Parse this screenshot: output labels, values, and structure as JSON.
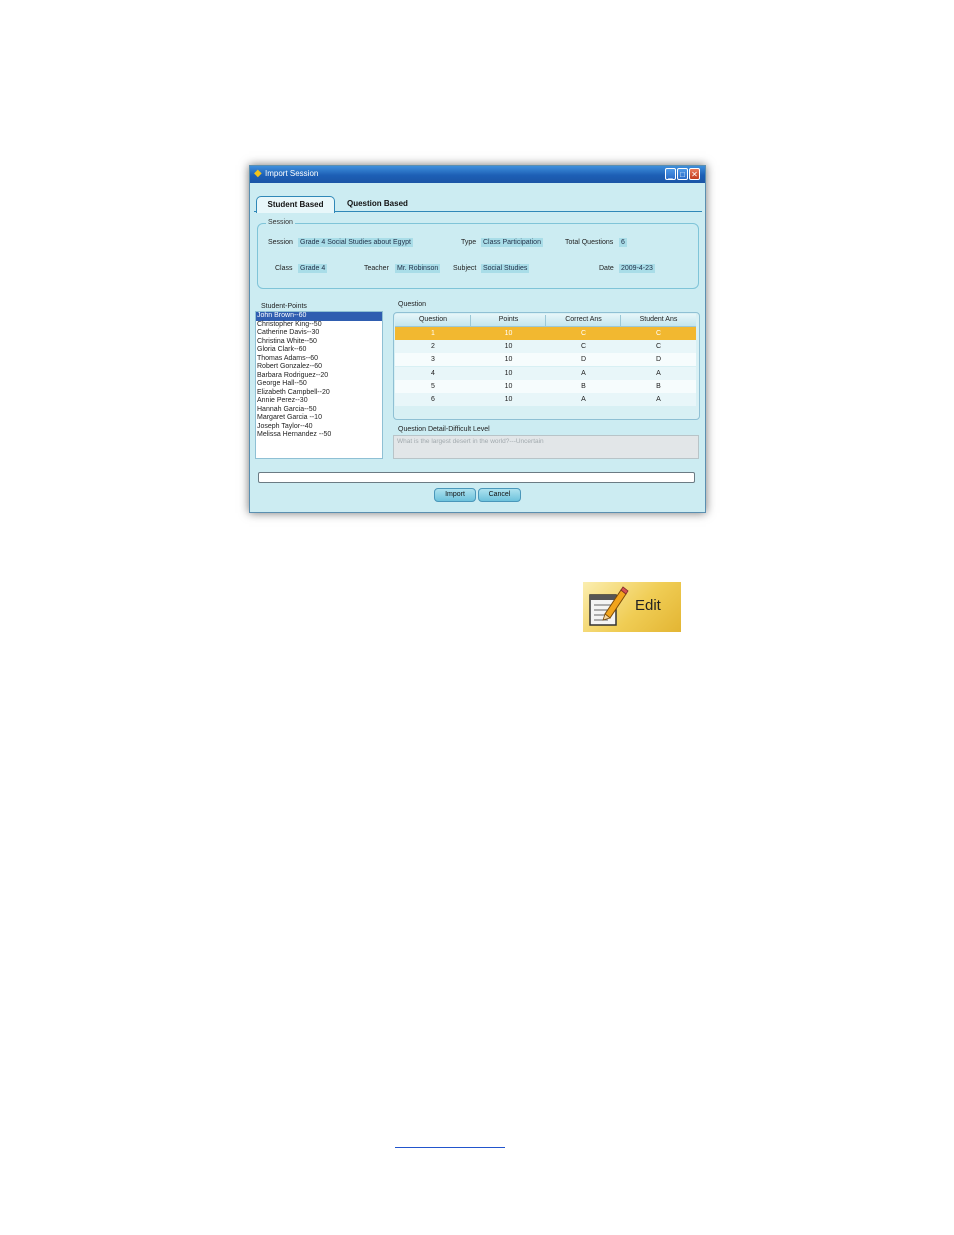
{
  "window": {
    "title": "Import Session",
    "app_icon": "app-icon",
    "controls": {
      "minimize_icon": "minimize-icon",
      "maximize_icon": "maximize-icon",
      "close_icon": "close-icon"
    }
  },
  "tabs": [
    {
      "label": "Student Based",
      "active": true
    },
    {
      "label": "Question Based",
      "active": false
    }
  ],
  "session": {
    "legend": "Session",
    "session_label": "Session",
    "session_value": "Grade 4 Social Studies about Egypt",
    "type_label": "Type",
    "type_value": "Class Participation",
    "total_label": "Total Questions",
    "total_value": "6",
    "class_label": "Class",
    "class_value": "Grade 4",
    "teacher_label": "Teacher",
    "teacher_value": "Mr. Robinson",
    "subject_label": "Subject",
    "subject_value": "Social Studies",
    "date_label": "Date",
    "date_value": "2009-4-23"
  },
  "students": {
    "legend": "Student-Points",
    "items": [
      "John Brown--60",
      "Christopher King--50",
      "Catherine Davis--30",
      "Christina White--50",
      "Gloria Clark--60",
      "Thomas Adams--60",
      "Robert Gonzalez--60",
      "Barbara Rodriguez--20",
      "George Hall--50",
      "Elizabeth Campbell--20",
      "Annie Perez--30",
      "Hannah Garcia--50",
      "Margaret Garcia --10",
      "Joseph Taylor--40",
      "Melissa Hernandez --50"
    ],
    "selected_index": 0
  },
  "questions": {
    "legend": "Question",
    "columns": [
      "Question",
      "Points",
      "Correct Ans",
      "Student Ans"
    ],
    "rows": [
      [
        "1",
        "10",
        "C",
        "C"
      ],
      [
        "2",
        "10",
        "C",
        "C"
      ],
      [
        "3",
        "10",
        "D",
        "D"
      ],
      [
        "4",
        "10",
        "A",
        "A"
      ],
      [
        "5",
        "10",
        "B",
        "B"
      ],
      [
        "6",
        "10",
        "A",
        "A"
      ]
    ],
    "selected_index": 0
  },
  "detail": {
    "legend": "Question Detail-Difficult Level",
    "text": "What is the largest desert in the world?---Uncertain"
  },
  "progress": {
    "value": 0
  },
  "buttons": {
    "import": "Import",
    "cancel": "Cancel"
  },
  "edit_badge": {
    "label": "Edit",
    "icon": "notepad-pencil-icon"
  },
  "colors": {
    "selection": "#2f5db0",
    "row_highlight": "#f2b830",
    "accent": "#a9dde8"
  }
}
